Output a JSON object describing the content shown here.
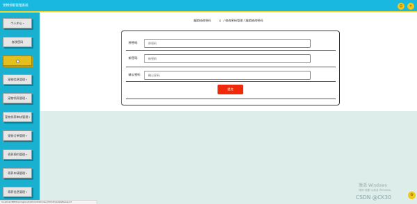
{
  "app": {
    "title": "宠物领取管理系统"
  },
  "header_icons": [
    "person-icon",
    "close-icon"
  ],
  "sidebar": {
    "items": [
      {
        "label": "个人中心",
        "has_arrow": true
      },
      {
        "label": "修改密码",
        "has_arrow": false
      },
      {
        "label": "",
        "has_arrow": false,
        "active": true
      },
      {
        "label": "宠物信息管理",
        "has_arrow": true
      },
      {
        "label": "宠物领养管理",
        "has_arrow": true
      },
      {
        "label": "宠物领养审核管理",
        "has_arrow": true
      },
      {
        "label": "宠物订单管理",
        "has_arrow": true
      },
      {
        "label": "寄养预约管理",
        "has_arrow": true
      },
      {
        "label": "寄养申请管理",
        "has_arrow": true
      },
      {
        "label": "寄养信息管理",
        "has_arrow": true
      }
    ]
  },
  "breadcrumb": {
    "page_title": "编辑修改密码",
    "trail": "/ 修改密码管理 / 编辑修改密码"
  },
  "form": {
    "fields": [
      {
        "label": "原密码",
        "placeholder": "原密码",
        "value": ""
      },
      {
        "label": "新密码",
        "placeholder": "新密码",
        "value": ""
      },
      {
        "label": "确认密码",
        "placeholder": "确认密码",
        "value": ""
      }
    ],
    "submit_label": "提交"
  },
  "watermark": {
    "line1": "激活 Windows",
    "line2": "转到\"设置\"以激活 Windows。",
    "csdn": "CSDN @CK30"
  },
  "statusbar": {
    "url": "localhost:8080/springboot/admin/dist/index.html#/updatePassword"
  },
  "colors": {
    "header": "#19b8e0",
    "header_border": "#f0d020",
    "sidebar": "#1ab0d0",
    "active_item": "#e3c01e",
    "submit": "#ee2a0a",
    "content_bg": "#ddeeea"
  }
}
